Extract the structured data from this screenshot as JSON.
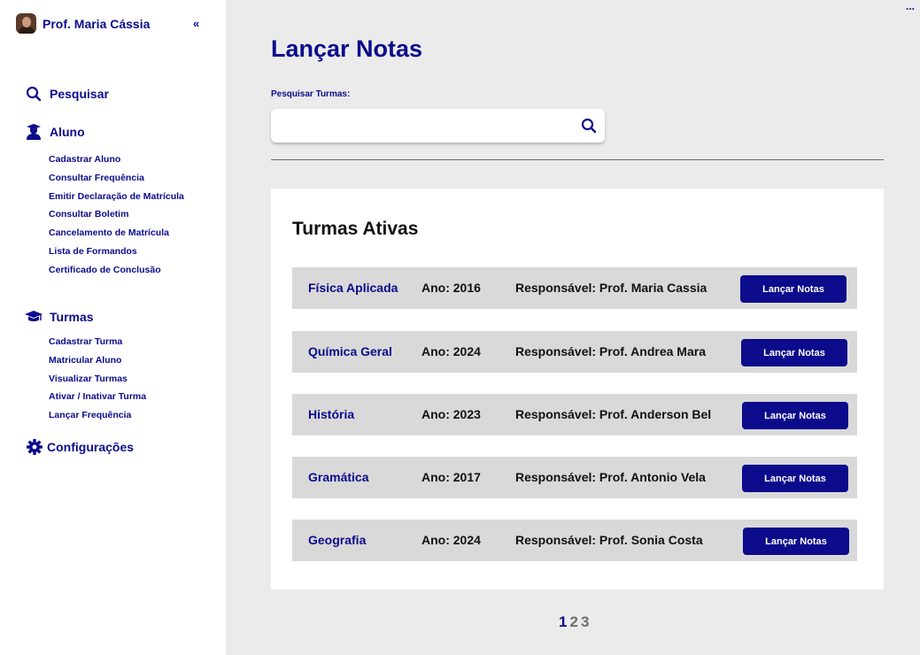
{
  "sidebar": {
    "profile_name": "Prof. Maria Cássia",
    "collapse_glyph": "«",
    "search_label": "Pesquisar",
    "aluno_label": "Aluno",
    "aluno_items": [
      "Cadastrar Aluno",
      "Consultar Frequência",
      "Emitir Declaração de Matrícula",
      "Consultar Boletim",
      "Cancelamento de Matrícula",
      "Lista de Formandos",
      "Certificado de Conclusão"
    ],
    "turmas_label": "Turmas",
    "turmas_items": [
      "Cadastrar Turma",
      "Matricular Aluno",
      "Visualizar Turmas",
      "Ativar / Inativar Turma",
      "Lançar Frequência"
    ],
    "config_label": "Configurações"
  },
  "header": {
    "more_glyph": "...",
    "title": "Lançar Notas",
    "search_label": "Pesquisar Turmas:",
    "search_value": "",
    "search_placeholder": ""
  },
  "panel": {
    "title": "Turmas Ativas",
    "rows": [
      {
        "name": "Física Aplicada",
        "year": "Ano: 2016",
        "resp": "Responsável: Prof. Maria Cassia",
        "button": "Lançar Notas"
      },
      {
        "name": "Química Geral",
        "year": "Ano: 2024",
        "resp": "Responsável: Prof. Andrea Mara",
        "button": "Lançar Notas"
      },
      {
        "name": "História",
        "year": "Ano: 2023",
        "resp": "Responsável: Prof. Anderson Bel",
        "button": "Lançar Notas"
      },
      {
        "name": "Gramática",
        "year": "Ano: 2017",
        "resp": "Responsável: Prof. Antonio Vela",
        "button": "Lançar Notas"
      },
      {
        "name": "Geografia",
        "year": "Ano: 2024",
        "resp": "Responsável: Prof. Sonia Costa",
        "button": "Lançar Notas"
      }
    ]
  },
  "pagination": {
    "pages": [
      "1",
      "2",
      "3"
    ],
    "current": "1"
  },
  "colors": {
    "brand": "#0b0b8c",
    "background": "#ebebeb",
    "row": "#d9d9d9"
  },
  "icons": {
    "search": "magnifier-icon",
    "aluno": "student-icon",
    "turmas": "graduation-cap-icon",
    "config": "gear-icon"
  }
}
